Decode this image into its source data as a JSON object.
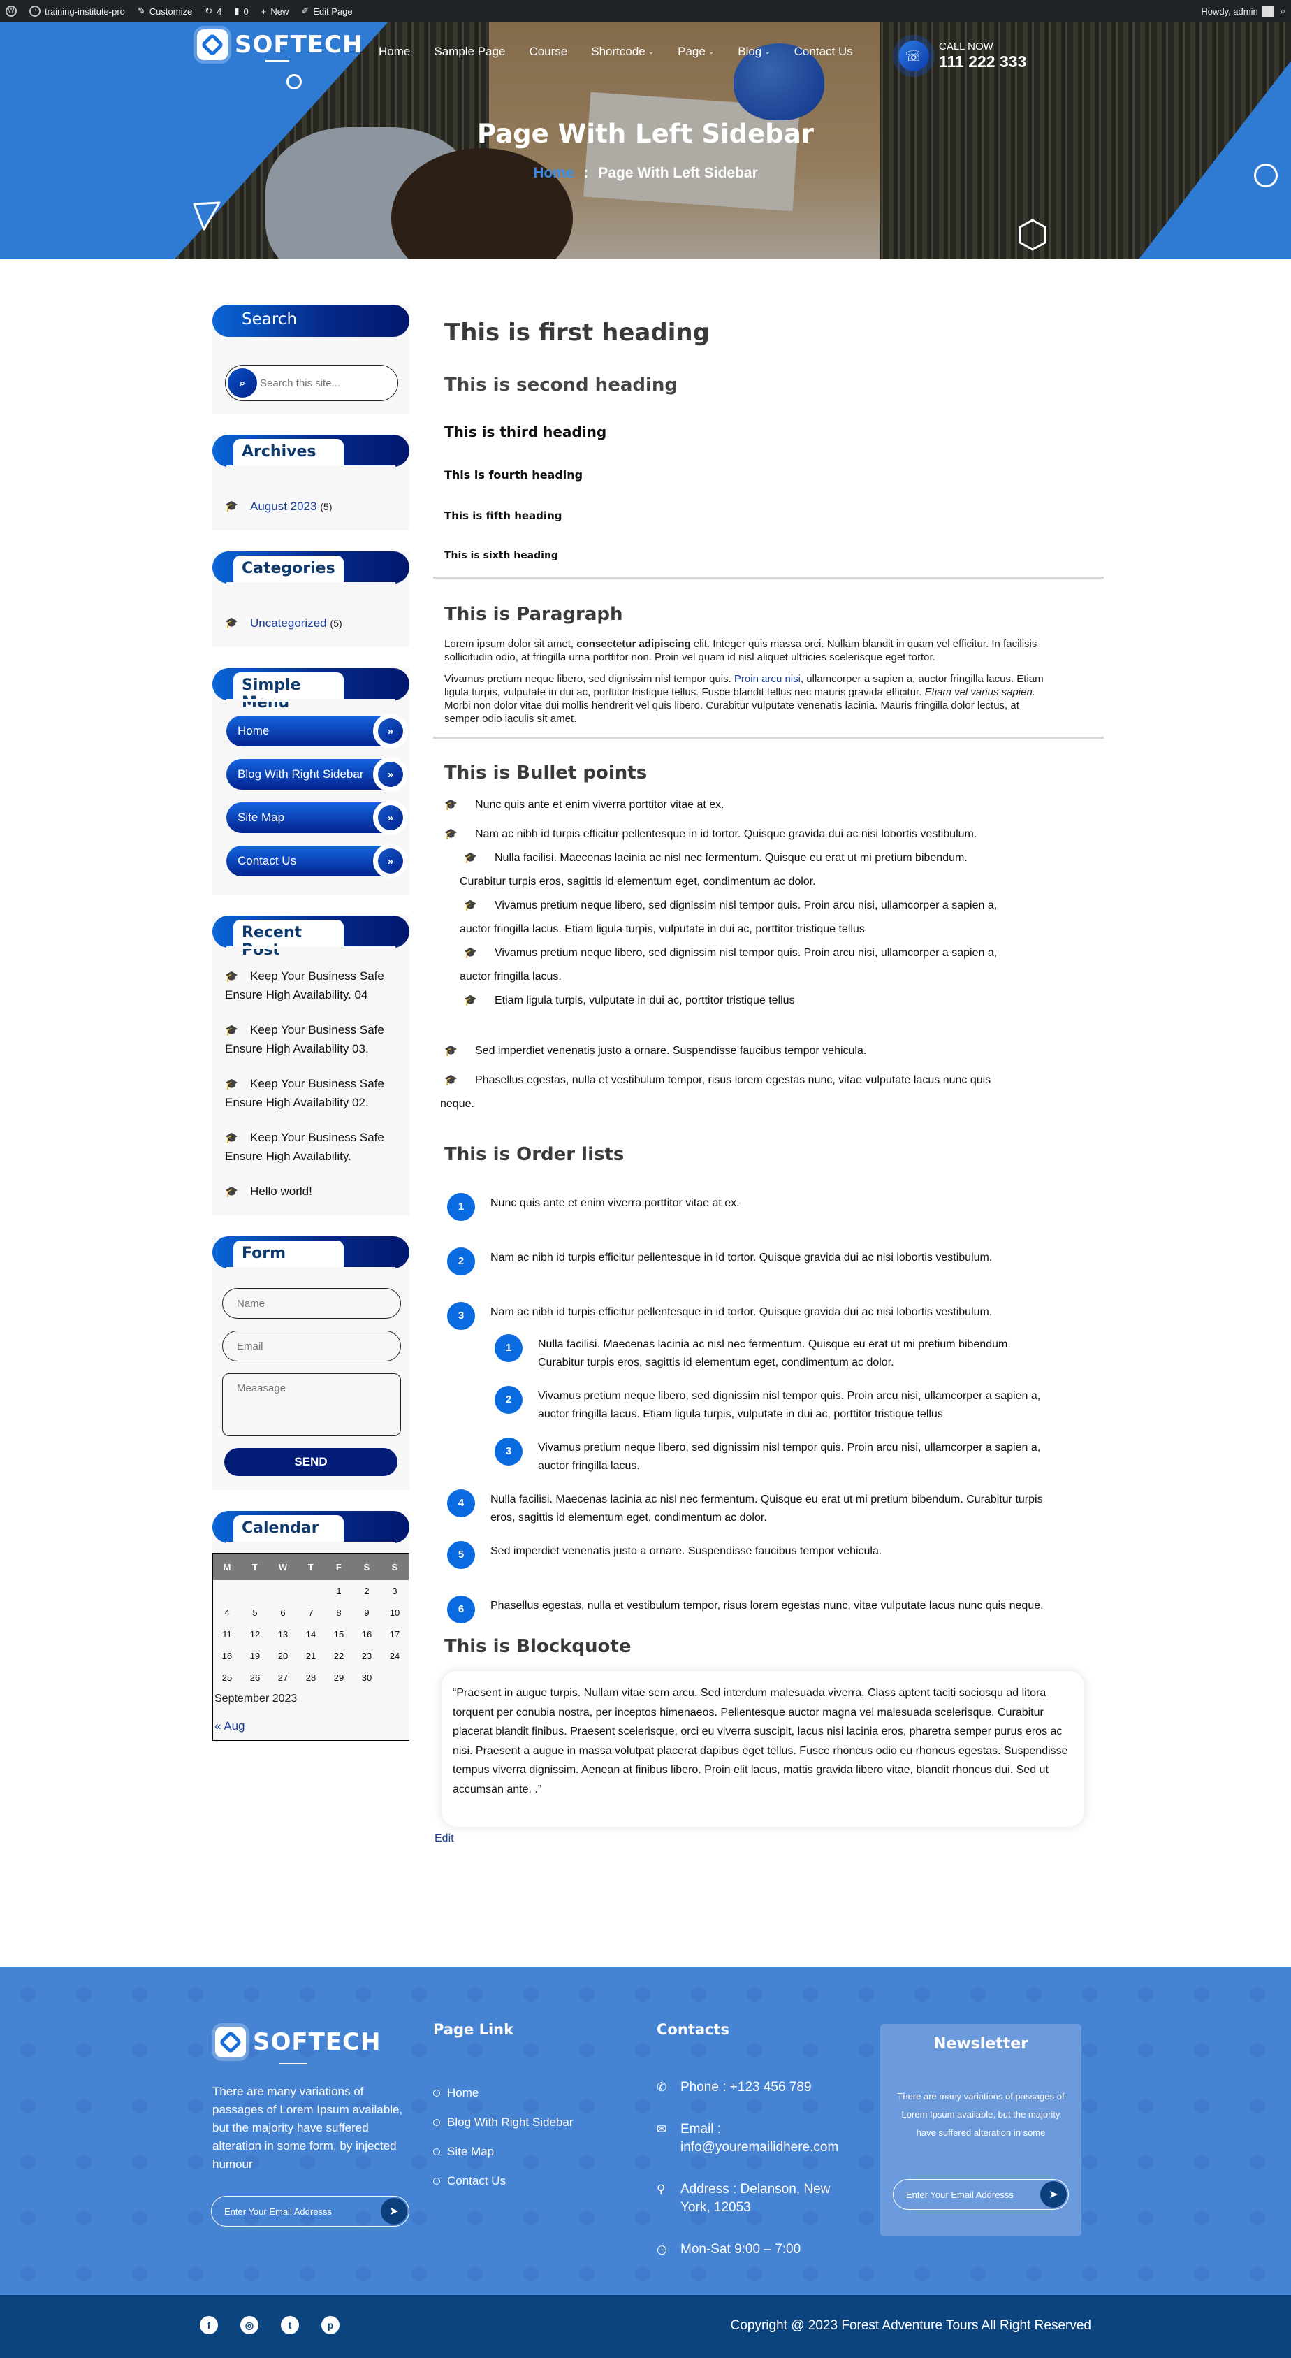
{
  "admin_bar": {
    "site_name": "training-institute-pro",
    "customize": "Customize",
    "updates_count": "4",
    "comments_count": "0",
    "new_label": "New",
    "edit_page": "Edit Page",
    "howdy": "Howdy, admin"
  },
  "header": {
    "logo_text": "SOFTECH",
    "nav": [
      {
        "label": "Home",
        "has_dropdown": false
      },
      {
        "label": "Sample Page",
        "has_dropdown": false
      },
      {
        "label": "Course",
        "has_dropdown": false
      },
      {
        "label": "Shortcode",
        "has_dropdown": true
      },
      {
        "label": "Page",
        "has_dropdown": true
      },
      {
        "label": "Blog",
        "has_dropdown": true
      },
      {
        "label": "Contact Us",
        "has_dropdown": false
      }
    ],
    "call_label": "CALL NOW",
    "call_number": "111 222 333",
    "chevron_glyph": "⌄"
  },
  "hero": {
    "title": "Page With Left Sidebar",
    "breadcrumb_home": "Home",
    "breadcrumb_sep": ":",
    "breadcrumb_current": "Page With Left Sidebar"
  },
  "sidebar": {
    "search": {
      "title": "Search",
      "placeholder": "Search this site..."
    },
    "archives": {
      "title": "Archives",
      "items": [
        {
          "label": "August 2023",
          "count": "(5)"
        }
      ]
    },
    "categories": {
      "title": "Categories",
      "items": [
        {
          "label": "Uncategorized",
          "count": "(5)"
        }
      ]
    },
    "simple_menu": {
      "title": "Simple Menu",
      "items": [
        "Home",
        "Blog With Right Sidebar",
        "Site Map",
        "Contact Us"
      ],
      "arrow_glyph": "»"
    },
    "recent_post": {
      "title": "Recent Post",
      "items": [
        "Keep Your Business Safe Ensure High Availability. 04",
        "Keep Your Business Safe Ensure High Availability 03.",
        "Keep Your Business Safe Ensure High Availability 02.",
        "Keep Your Business Safe Ensure High Availability.",
        "Hello world!"
      ]
    },
    "form": {
      "title": "Form",
      "name_placeholder": "Name",
      "email_placeholder": "Email",
      "message_placeholder": "Meaasage",
      "send_label": "SEND"
    },
    "calendar": {
      "title": "Calendar",
      "weekdays": [
        "M",
        "T",
        "W",
        "T",
        "F",
        "S",
        "S"
      ],
      "weeks": [
        [
          "",
          "",
          "",
          "",
          "1",
          "2",
          "3"
        ],
        [
          "4",
          "5",
          "6",
          "7",
          "8",
          "9",
          "10"
        ],
        [
          "11",
          "12",
          "13",
          "14",
          "15",
          "16",
          "17"
        ],
        [
          "18",
          "19",
          "20",
          "21",
          "22",
          "23",
          "24"
        ],
        [
          "25",
          "26",
          "27",
          "28",
          "29",
          "30",
          ""
        ]
      ],
      "month": "September 2023",
      "prev_link": "« Aug"
    }
  },
  "main": {
    "headings": [
      "This is first heading",
      "This is second heading",
      "This is third heading",
      "This is fourth heading",
      "This is fifth heading",
      "This is sixth heading"
    ],
    "paragraph_title": "This is Paragraph",
    "p1_before": "Lorem ipsum dolor sit amet, ",
    "p1_bold": "consectetur adipiscing",
    "p1_after": " elit. Integer quis massa orci. Nullam blandit in quam vel efficitur. In facilisis sollicitudin odio, at fringilla urna porttitor non. Proin vel quam id nisl aliquet ultricies scelerisque eget tortor.",
    "p2_before": "Vivamus pretium neque libero, sed dignissim nisl tempor quis. ",
    "p2_link": "Proin arcu nisi",
    "p2_mid": ", ullamcorper a sapien a, auctor fringilla lacus. Etiam ligula turpis, vulputate in dui ac, porttitor tristique tellus. Fusce blandit tellus nec mauris gravida efficitur. ",
    "p2_italic": "Etiam vel varius sapien.",
    "p2_after": " Morbi non dolor vitae dui mollis hendrerit vel quis libero. Curabitur vulputate venenatis lacinia. Mauris fringilla dolor lectus, at semper odio iaculis sit amet.",
    "bullets_title": "This is Bullet points",
    "bullets": [
      "Nunc quis ante et enim viverra porttitor vitae at ex.",
      "Nam ac nibh id turpis efficitur pellentesque in id tortor. Quisque gravida dui ac nisi lobortis vestibulum."
    ],
    "sub_bullets": [
      {
        "first": "Nulla facilisi. Maecenas lacinia ac nisl nec fermentum. Quisque eu erat ut mi pretium bibendum.",
        "rest": "Curabitur turpis eros, sagittis id elementum eget, condimentum ac dolor."
      },
      {
        "first": "Vivamus pretium neque libero, sed dignissim nisl tempor quis. Proin arcu nisi, ullamcorper a sapien a,",
        "rest": "auctor fringilla lacus. Etiam ligula turpis, vulputate in dui ac, porttitor tristique tellus"
      },
      {
        "first": "Vivamus pretium neque libero, sed dignissim nisl tempor quis. Proin arcu nisi, ullamcorper a sapien a,",
        "rest": "auctor fringilla lacus."
      },
      {
        "first": "Etiam ligula turpis, vulputate in dui ac, porttitor tristique tellus",
        "rest": ""
      }
    ],
    "bullets_after": [
      {
        "first": "Sed imperdiet venenatis justo a ornare. Suspendisse faucibus tempor vehicula.",
        "rest": ""
      },
      {
        "first": "Phasellus egestas, nulla et vestibulum tempor, risus lorem egestas nunc, vitae vulputate lacus nunc quis",
        "rest": "neque."
      }
    ],
    "order_title": "This is Order lists",
    "ordered": [
      {
        "n": "1",
        "text": "Nunc quis ante et enim viverra porttitor vitae at ex."
      },
      {
        "n": "2",
        "text": "Nam ac nibh id turpis efficitur pellentesque in id tortor. Quisque gravida dui ac nisi lobortis vestibulum."
      },
      {
        "n": "3",
        "text": "Nam ac nibh id turpis efficitur pellentesque in id tortor. Quisque gravida dui ac nisi lobortis vestibulum."
      }
    ],
    "ordered_sub": [
      {
        "n": "1",
        "text": "Nulla facilisi. Maecenas lacinia ac nisl nec fermentum. Quisque eu erat ut mi pretium bibendum. Curabitur turpis eros, sagittis id elementum eget, condimentum ac dolor."
      },
      {
        "n": "2",
        "text": "Vivamus pretium neque libero, sed dignissim nisl tempor quis. Proin arcu nisi, ullamcorper a sapien a, auctor fringilla lacus. Etiam ligula turpis, vulputate in dui ac, porttitor tristique tellus"
      },
      {
        "n": "3",
        "text": "Vivamus pretium neque libero, sed dignissim nisl tempor quis. Proin arcu nisi, ullamcorper a sapien a, auctor fringilla lacus."
      }
    ],
    "ordered_after": [
      {
        "n": "4",
        "text": "Nulla facilisi. Maecenas lacinia ac nisl nec fermentum. Quisque eu erat ut mi pretium bibendum. Curabitur turpis eros, sagittis id elementum eget, condimentum ac dolor."
      },
      {
        "n": "5",
        "text": "Sed imperdiet venenatis justo a ornare. Suspendisse faucibus tempor vehicula."
      },
      {
        "n": "6",
        "text": "Phasellus egestas, nulla et vestibulum tempor, risus lorem egestas nunc, vitae vulputate lacus nunc quis neque."
      }
    ],
    "blockquote_title": "This is Blockquote",
    "blockquote": "“Praesent in augue turpis. Nullam vitae sem arcu. Sed interdum malesuada viverra. Class aptent taciti sociosqu ad litora torquent per conubia nostra, per inceptos himenaeos. Pellentesque auctor magna vel malesuada scelerisque. Curabitur placerat blandit finibus. Praesent scelerisque, orci eu viverra suscipit, lacus nisi lacinia eros, pharetra semper purus eros ac nisi. Praesent a augue in massa volutpat placerat dapibus eget tellus. Fusce rhoncus odio eu rhoncus egestas. Suspendisse tempus viverra dignissim. Aenean at finibus libero. Proin elit lacus, mattis gravida libero vitae, blandit rhoncus dui. Sed ut accumsan ante. .”",
    "edit_link": "Edit"
  },
  "footer": {
    "logo_text": "SOFTECH",
    "description": "There are many variations of passages of Lorem Ipsum available, but the majority have suffered alteration in some form, by injected humour",
    "subscribe_placeholder": "Enter Your Email Addresss",
    "page_link_title": "Page Link",
    "page_links": [
      "Home",
      "Blog With Right Sidebar",
      "Site Map",
      "Contact Us"
    ],
    "contacts_title": "Contacts",
    "phone": "Phone : +123 456 789",
    "email": "Email : info@youremailidhere.com",
    "address": "Address : Delanson, New York, 12053",
    "hours": "Mon-Sat 9:00 – 7:00",
    "newsletter_title": "Newsletter",
    "newsletter_desc": "There are many variations of passages of Lorem Ipsum available, but the majority have suffered alteration in some",
    "newsletter_placeholder": "Enter Your Email Addresss",
    "socials": [
      {
        "name": "facebook",
        "glyph": "f"
      },
      {
        "name": "instagram",
        "glyph": "◎"
      },
      {
        "name": "twitter",
        "glyph": "t"
      },
      {
        "name": "pinterest",
        "glyph": "p"
      }
    ],
    "copyright": "Copyright @ 2023 Forest Adventure Tours All Right Reserved"
  },
  "colors": {
    "primary_blue": "#0a6be0",
    "dark_navy": "#02186e",
    "footer_blue": "#4683d3",
    "footer_bottom": "#0c447f",
    "admin_bar": "#1d2327"
  }
}
